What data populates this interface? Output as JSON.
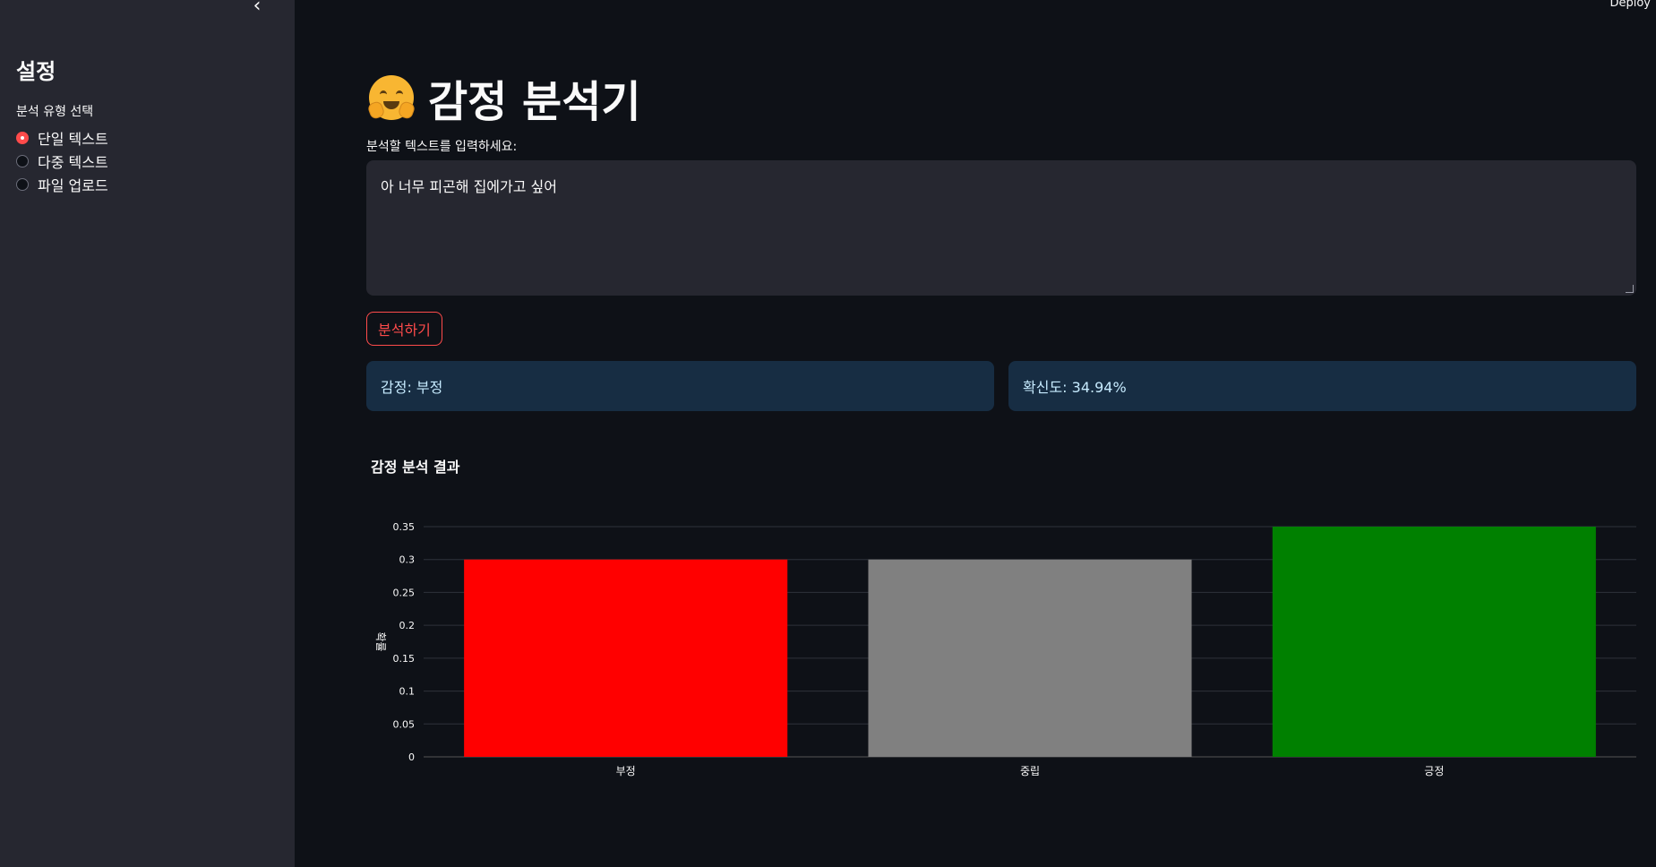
{
  "sidebar": {
    "collapse_icon": "‹",
    "heading": "설정",
    "radio_label": "분석 유형 선택",
    "options": [
      "단일 텍스트",
      "다중 텍스트",
      "파일 업로드"
    ],
    "selected_index": 0
  },
  "header": {
    "deploy_label": "Deploy"
  },
  "main": {
    "title": "감정 분석기",
    "title_icon": "hugging-face-emoji",
    "input_label": "분석할 텍스트를 입력하세요:",
    "input_value": "아 너무 피곤해 집에가고 싶어",
    "analyze_button": "분석하기",
    "emotion_result": "감정: 부정",
    "confidence_result": "확신도: 34.94%",
    "chart_heading": "감정 분석 결과"
  },
  "colors": {
    "accent": "#ff4b4b",
    "info_bg": "#172d43",
    "bar_negative": "#ff0000",
    "bar_neutral": "#808080",
    "bar_positive": "#008000"
  },
  "chart_data": {
    "type": "bar",
    "categories": [
      "부정",
      "중립",
      "긍정"
    ],
    "values": [
      0.3,
      0.3,
      0.35
    ],
    "colors": [
      "#ff0000",
      "#808080",
      "#008000"
    ],
    "ylabel": "확률",
    "ylim": [
      0,
      0.35
    ],
    "yticks": [
      "0",
      "0.05",
      "0.1",
      "0.15",
      "0.2",
      "0.25",
      "0.3",
      "0.35"
    ],
    "grid": true
  }
}
